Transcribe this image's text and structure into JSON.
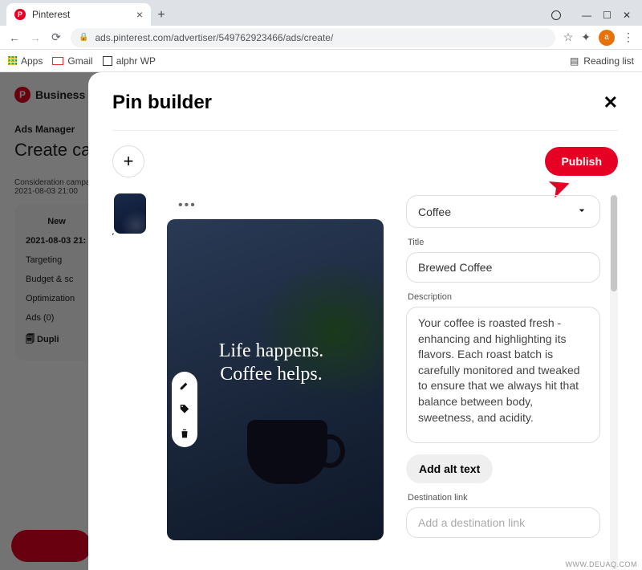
{
  "browser": {
    "tab_title": "Pinterest",
    "url": "ads.pinterest.com/advertiser/549762923466/ads/create/",
    "bookmarks": {
      "apps": "Apps",
      "gmail": "Gmail",
      "alphr": "alphr WP"
    },
    "reading_list": "Reading list",
    "avatar_initial": "a"
  },
  "background": {
    "business_label": "Business",
    "ads_manager": "Ads Manager",
    "page_title": "Create can",
    "campaign_line1": "Consideration campa",
    "campaign_line2": "2021-08-03 21:00",
    "sidebar": {
      "new": "New",
      "date": "2021-08-03 21:",
      "items": [
        "Targeting",
        "Budget & sc",
        "Optimization",
        "Ads (0)"
      ],
      "duplicate": "Dupli"
    }
  },
  "modal": {
    "title": "Pin builder",
    "publish": "Publish",
    "board_selected": "Coffee",
    "labels": {
      "title": "Title",
      "description": "Description",
      "dest": "Destination link"
    },
    "fields": {
      "title": "Brewed Coffee",
      "description": "Your coffee is roasted fresh - enhancing and highlighting its flavors. Each roast batch is carefully monitored and tweaked to ensure that we always hit that balance between body, sweetness, and acidity.",
      "dest_placeholder": "Add a destination link"
    },
    "alt_text_btn": "Add alt text",
    "image_quote": "Life happens.\nCoffee helps."
  },
  "watermark": "WWW.DEUAQ.COM"
}
